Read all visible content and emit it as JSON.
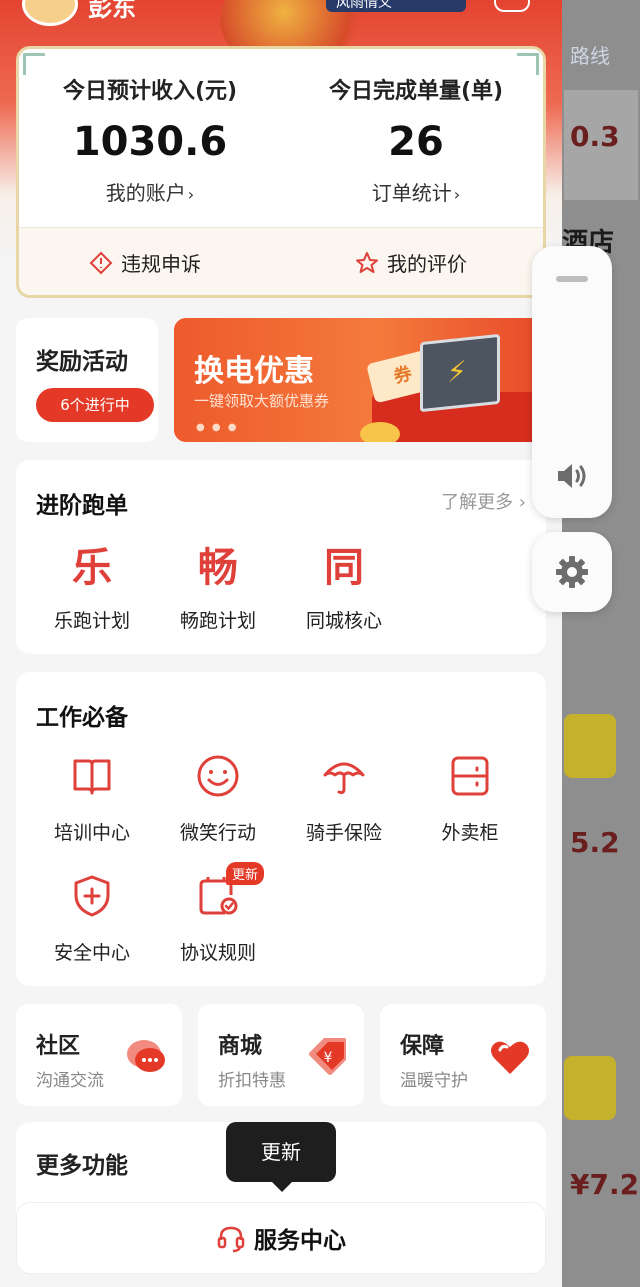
{
  "header": {
    "user_name": "彭东",
    "badge_text": "风雨情义"
  },
  "income": {
    "left_label": "今日预计收入(元)",
    "left_value": "1030.6",
    "left_link": "我的账户",
    "right_label": "今日完成单量(单)",
    "right_value": "26",
    "right_link": "订单统计",
    "footer_left": "违规申诉",
    "footer_right": "我的评价"
  },
  "reward": {
    "title": "奖励活动",
    "pill": "6个进行中"
  },
  "banner": {
    "title": "换电优惠",
    "subtitle": "一键领取大额优惠券",
    "coupon_text": "券"
  },
  "advanced": {
    "title": "进阶跑单",
    "more": "了解更多 ›",
    "items": [
      {
        "glyph": "乐",
        "label": "乐跑计划"
      },
      {
        "glyph": "畅",
        "label": "畅跑计划"
      },
      {
        "glyph": "同",
        "label": "同城核心"
      }
    ]
  },
  "work": {
    "title": "工作必备",
    "items": [
      {
        "label": "培训中心",
        "icon": "book-icon"
      },
      {
        "label": "微笑行动",
        "icon": "smile-icon"
      },
      {
        "label": "骑手保险",
        "icon": "umbrella-icon"
      },
      {
        "label": "外卖柜",
        "icon": "cabinet-icon"
      },
      {
        "label": "安全中心",
        "icon": "shield-plus-icon"
      },
      {
        "label": "协议规则",
        "icon": "document-check-icon"
      }
    ],
    "new_tag": "更新"
  },
  "cards": [
    {
      "title": "社区",
      "subtitle": "沟通交流",
      "icon": "chat-bubble-icon"
    },
    {
      "title": "商城",
      "subtitle": "折扣特惠",
      "icon": "price-tag-icon"
    },
    {
      "title": "保障",
      "subtitle": "温暖守护",
      "icon": "heart-icon"
    }
  ],
  "more_functions": {
    "title": "更多功能"
  },
  "tooltip": "更新",
  "service": {
    "label": "服务中心"
  },
  "background": {
    "route_link": "路线",
    "value_1": "0.3",
    "store_text": "酒店",
    "value_2": "5.2",
    "value_3": "¥7.2"
  },
  "colors": {
    "accent": "#e53927",
    "header_red": "#e34431"
  }
}
